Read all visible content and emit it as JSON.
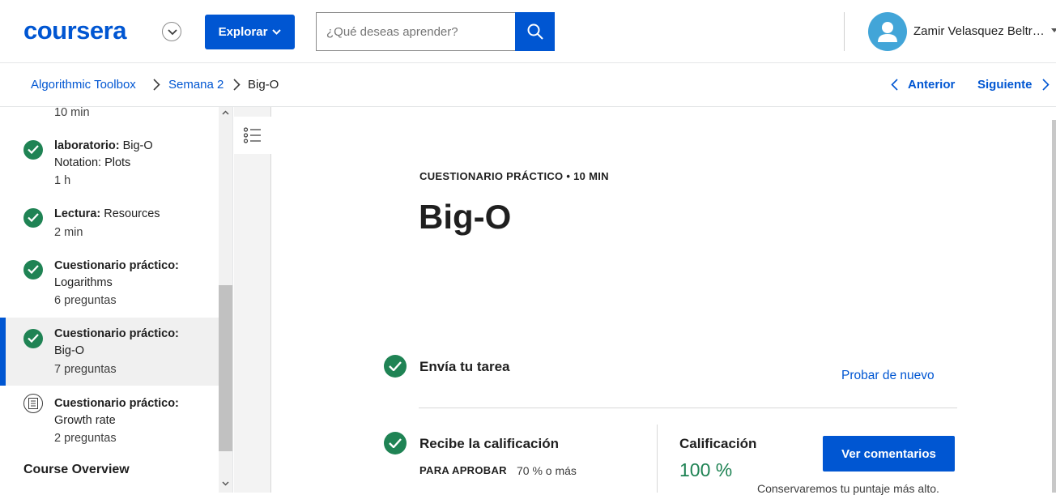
{
  "header": {
    "logo_text": "coursera",
    "explore_label": "Explorar",
    "search_placeholder": "¿Qué deseas aprender?",
    "user_name": "Zamir Velasquez Beltr…",
    "brand_color": "#0056d2"
  },
  "breadcrumb": {
    "items": [
      "Algorithmic Toolbox",
      "Semana 2",
      "Big-O"
    ],
    "prev_label": "Anterior",
    "next_label": "Siguiente"
  },
  "sidebar": {
    "items": [
      {
        "type": "",
        "title": "",
        "meta": "10 min",
        "status": "completed"
      },
      {
        "type": "laboratorio:",
        "title": "Big-O",
        "title2": "Notation: Plots",
        "meta": "1 h",
        "status": "completed"
      },
      {
        "type": "Lectura:",
        "title": "Resources",
        "meta": "2 min",
        "status": "completed"
      },
      {
        "type": "Cuestionario práctico:",
        "title": "Logarithms",
        "meta": "6 preguntas",
        "status": "completed"
      },
      {
        "type": "Cuestionario práctico:",
        "title": "Big-O",
        "meta": "7 preguntas",
        "status": "completed",
        "active": true
      },
      {
        "type": "Cuestionario práctico:",
        "title": "Growth rate",
        "meta": "2 preguntas",
        "status": "not-started"
      }
    ],
    "section_heading": "Course Overview"
  },
  "main": {
    "eyebrow": "CUESTIONARIO PRÁCTICO • 10 MIN",
    "title": "Big-O",
    "step1_title": "Envía tu tarea",
    "retry_label": "Probar de nuevo",
    "step2_title": "Recibe la calificación",
    "pass_label": "PARA APROBAR",
    "pass_value": "70 % o más",
    "grade_label": "Calificación",
    "grade_value": "100 %",
    "feedback_label": "Ver comentarios",
    "keep_note": "Conservaremos tu puntaje más alto.",
    "success_color": "#1f8354"
  }
}
